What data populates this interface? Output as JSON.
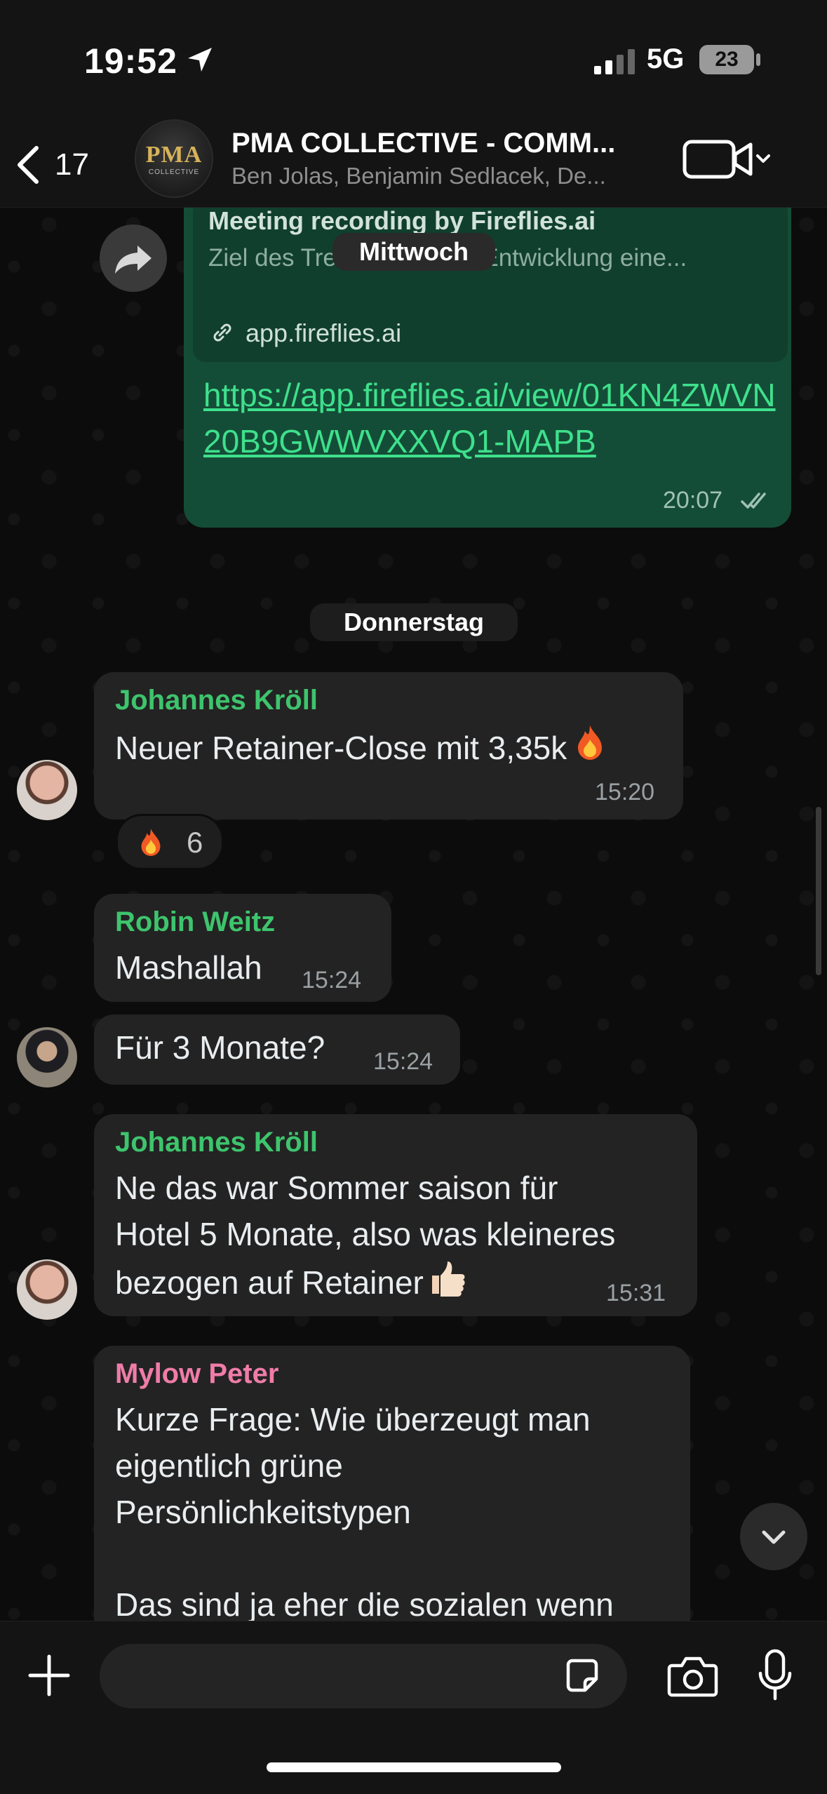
{
  "status_bar": {
    "time": "19:52",
    "network": "5G",
    "battery": "23"
  },
  "header": {
    "back_count": "17",
    "group_name": "PMA COLLECTIVE - COMM...",
    "members": "Ben Jolas, Benjamin Sedlacek, De...",
    "avatar_logo": "PMA",
    "avatar_logo_sub": "COLLECTIVE"
  },
  "day_separators": {
    "wednesday": "Mittwoch",
    "thursday": "Donnerstag"
  },
  "link_message": {
    "preview_title": "Meeting recording by Fireflies.ai",
    "preview_desc": "Ziel des Treffens war die Entwicklung eine...",
    "preview_domain": "app.fireflies.ai",
    "url": "https://app.fireflies.ai/view/01KN4ZWVN20B9GWWVXXVQ1-MAPB",
    "time": "20:07"
  },
  "messages": [
    {
      "sender": "Johannes Kröll",
      "text": "Neuer Retainer-Close mit 3,35k",
      "time": "15:20"
    },
    {
      "reaction_emoji": "fire",
      "reaction_count": "6"
    },
    {
      "sender": "Robin Weitz",
      "text": "Mashallah",
      "time": "15:24"
    },
    {
      "text": "Für 3 Monate?",
      "time": "15:24"
    },
    {
      "sender": "Johannes Kröll",
      "text": "Ne das war Sommer saison für\nHotel 5 Monate, also was kleineres\nbezogen auf Retainer",
      "time": "15:31"
    },
    {
      "sender": "Mylow Peter",
      "text": "Kurze Frage: Wie überzeugt man\neigentlich grüne\nPersönlichkeitstypen\n\nDas sind ja eher die sozialen wenn"
    }
  ],
  "colors": {
    "outgoing_bubble": "#144d37",
    "incoming_bubble": "#232323",
    "sender_green": "#3ec46d",
    "sender_pink": "#f07ca8",
    "link": "#3ee08c"
  },
  "icons": {
    "back": "chevron-left-icon",
    "video": "video-camera-icon",
    "forward": "forward-arrow-icon",
    "link": "link-chain-icon",
    "double_check": "double-check-icon",
    "scroll_down": "chevron-down-icon",
    "plus": "plus-icon",
    "sticker": "sticker-icon",
    "camera": "camera-icon",
    "mic": "microphone-icon"
  }
}
